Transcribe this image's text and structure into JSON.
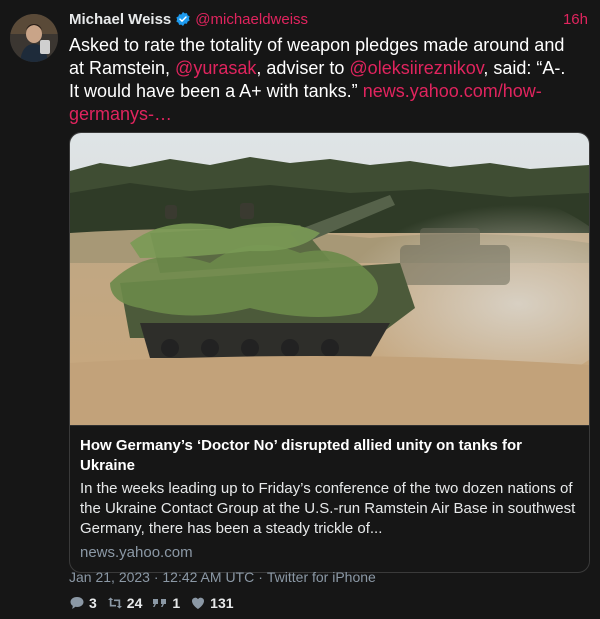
{
  "author": {
    "display_name": "Michael Weiss",
    "handle": "@michaeldweiss",
    "time": "16h",
    "avatar_icon": "user-avatar",
    "verified_icon": "verified-badge-icon"
  },
  "tweet": {
    "text_part1": "Asked to rate the totality of weapon pledges made around and at Ramstein, ",
    "mention1": "@yurasak",
    "text_part2": ", adviser to ",
    "mention2": "@oleksiireznikov",
    "text_part3": ", said: “A-. It would have been a A+ with tanks.” ",
    "link": "news.yahoo.com/how-germanys-…"
  },
  "card": {
    "title": "How Germany’s ‘Doctor No’ disrupted allied unity on tanks for Ukraine",
    "description": "In the weeks leading up to Friday’s conference of the two dozen nations of the Ukraine Contact Group at the U.S.-run Ramstein Air Base in southwest Germany, there has been a steady trickle of...",
    "domain": "news.yahoo.com",
    "image_icon": "tank-photo"
  },
  "meta": {
    "date": "Jan 21, 2023 · 12:42 AM UTC",
    "separator": "·",
    "source": "Twitter for iPhone"
  },
  "stats": {
    "replies": "3",
    "retweets": "24",
    "quotes": "1",
    "likes": "131"
  },
  "colors": {
    "background": "#161616",
    "accent": "#e0245e",
    "muted": "#8b98a5",
    "verified": "#1d9bf0"
  }
}
